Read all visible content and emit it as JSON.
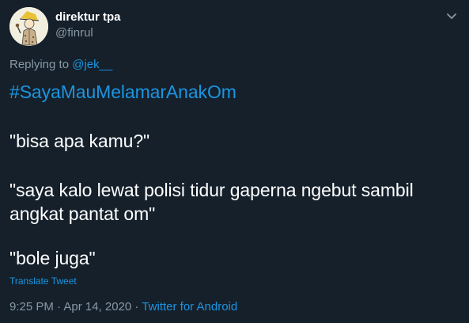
{
  "tweet": {
    "author": {
      "display_name": "direktur tpa",
      "handle": "@finrul",
      "avatar_icon": "avatar-illustration"
    },
    "menu_icon": "chevron-down-icon",
    "reply": {
      "prefix": "Replying to ",
      "mention": "@jek__"
    },
    "hashtag": "#SayaMauMelamarAnakOm",
    "lines": [
      "\"bisa apa kamu?\"",
      "\"saya kalo lewat polisi tidur gaperna ngebut sambil",
      "angkat pantat om\"",
      "\"bole juga\""
    ],
    "translate_label": "Translate Tweet",
    "timestamp": "9:25 PM · Apr 14, 2020 · ",
    "source": "Twitter for Android"
  },
  "colors": {
    "background": "#15202b",
    "text": "#ffffff",
    "secondary": "#8899a6",
    "accent": "#1b95e0"
  }
}
